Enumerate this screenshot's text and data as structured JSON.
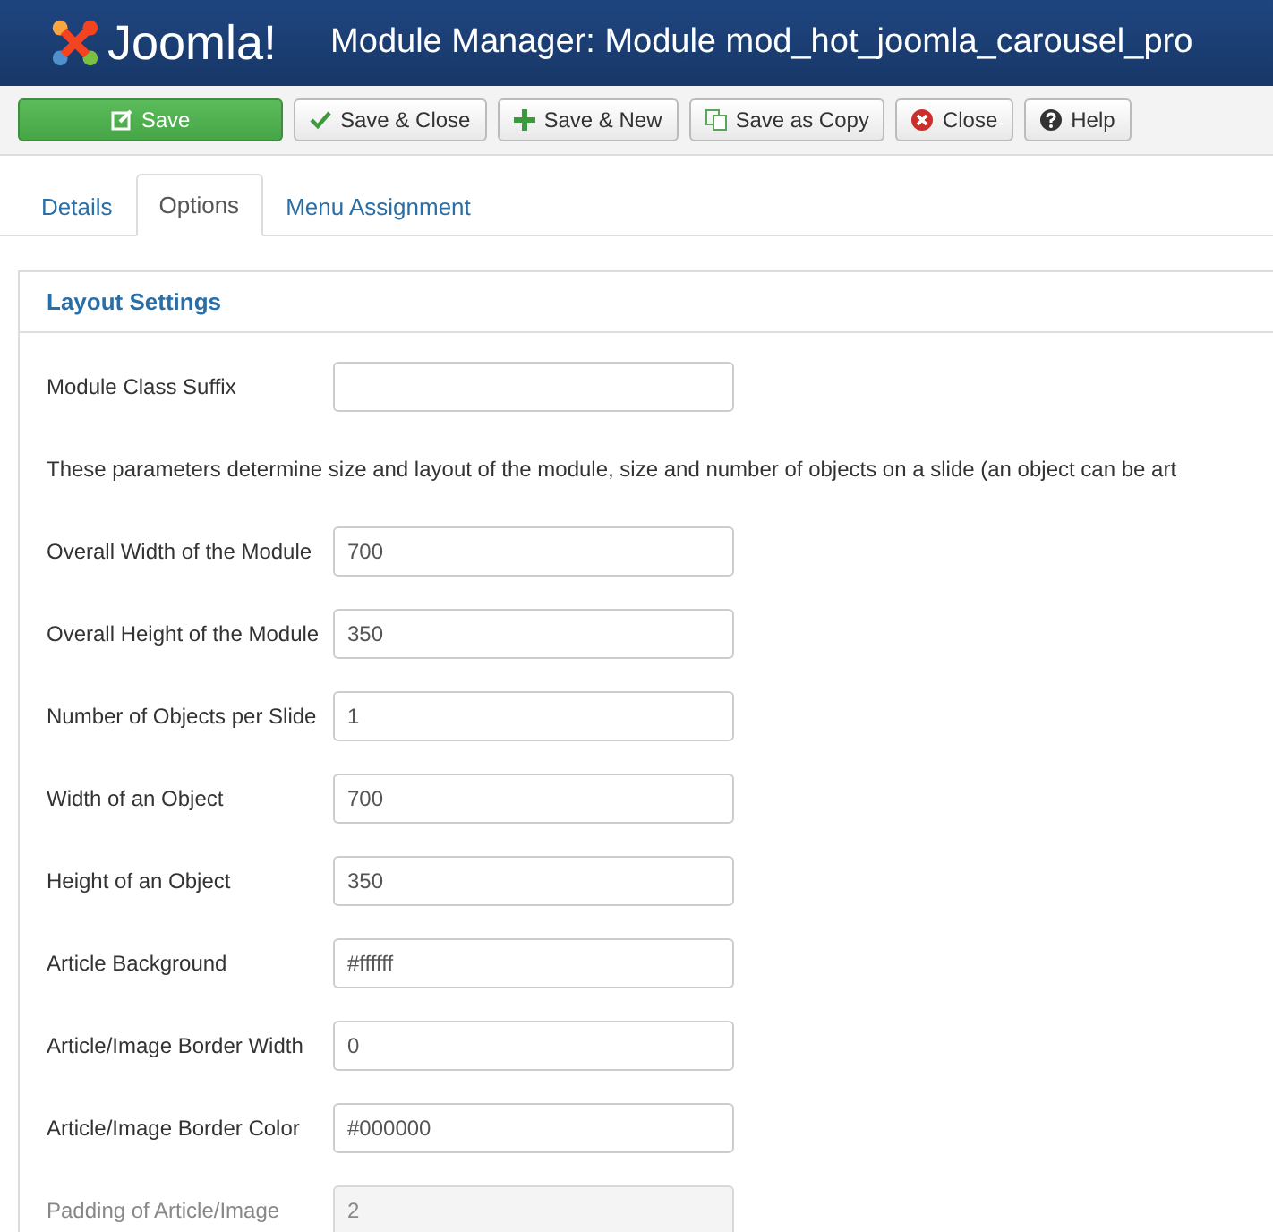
{
  "header": {
    "logo": "Joomla!",
    "title": "Module Manager: Module mod_hot_joomla_carousel_pro"
  },
  "toolbar": [
    {
      "kind": "save",
      "label": "Save"
    },
    {
      "kind": "check",
      "label": "Save & Close"
    },
    {
      "kind": "plus",
      "label": "Save & New"
    },
    {
      "kind": "copy",
      "label": "Save as Copy"
    },
    {
      "kind": "close",
      "label": "Close"
    },
    {
      "kind": "help",
      "label": "Help"
    }
  ],
  "tabs": [
    {
      "label": "Details",
      "selected": false
    },
    {
      "label": "Options",
      "selected": true
    },
    {
      "label": "Menu Assignment",
      "selected": false
    }
  ],
  "panel": {
    "title": "Layout Settings",
    "items": [
      {
        "kind": "field",
        "label": "Module Class Suffix",
        "value": "",
        "disabled": false
      },
      {
        "kind": "note",
        "text": "These parameters determine size and layout of the module, size and number of objects on a slide (an object can be art"
      },
      {
        "kind": "field",
        "label": "Overall Width of the Module",
        "value": "700",
        "disabled": false
      },
      {
        "kind": "field",
        "label": "Overall Height of the Module",
        "value": "350",
        "disabled": false
      },
      {
        "kind": "field",
        "label": "Number of Objects per Slide",
        "value": "1",
        "disabled": false
      },
      {
        "kind": "field",
        "label": "Width of an Object",
        "value": "700",
        "disabled": false
      },
      {
        "kind": "field",
        "label": "Height of an Object",
        "value": "350",
        "disabled": false
      },
      {
        "kind": "field",
        "label": "Article Background",
        "value": "#ffffff",
        "disabled": false
      },
      {
        "kind": "field",
        "label": "Article/Image Border Width",
        "value": "0",
        "disabled": false
      },
      {
        "kind": "field",
        "label": "Article/Image Border Color",
        "value": "#000000",
        "disabled": false
      },
      {
        "kind": "field",
        "label": "Padding of Article/Image",
        "value": "2",
        "disabled": true
      }
    ]
  }
}
